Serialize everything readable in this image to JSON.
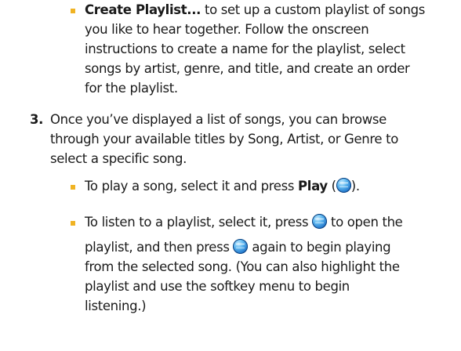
{
  "bullet1": {
    "bold": "Create Playlist...",
    "lines": [
      " to set up a custom playlist of songs",
      "you like to hear together. Follow the onscreen",
      "instructions to create a name for the playlist, select",
      "songs by artist, genre, and title, and create an order",
      "for the playlist."
    ]
  },
  "step3": {
    "number": "3.",
    "lines": [
      "Once you’ve displayed a list of songs, you can browse",
      "through your available titles by Song, Artist, or Genre to",
      "select a specific song."
    ]
  },
  "bullet2": {
    "pre": "To play a song, select it and press ",
    "bold": "Play",
    "open": " (",
    "close": ")."
  },
  "bullet3": {
    "line1_pre": "To listen to a playlist, select it, press ",
    "line1_post": " to open the",
    "line2_pre": "playlist, and then press ",
    "line2_post": " again to begin playing",
    "lines": [
      "from the selected song. (You can also highlight the",
      "playlist and use the softkey menu to begin",
      "listening.)"
    ]
  },
  "icons": {
    "menu_ok": "menu-ok-key-icon",
    "bullet_color": "#f0b323"
  }
}
